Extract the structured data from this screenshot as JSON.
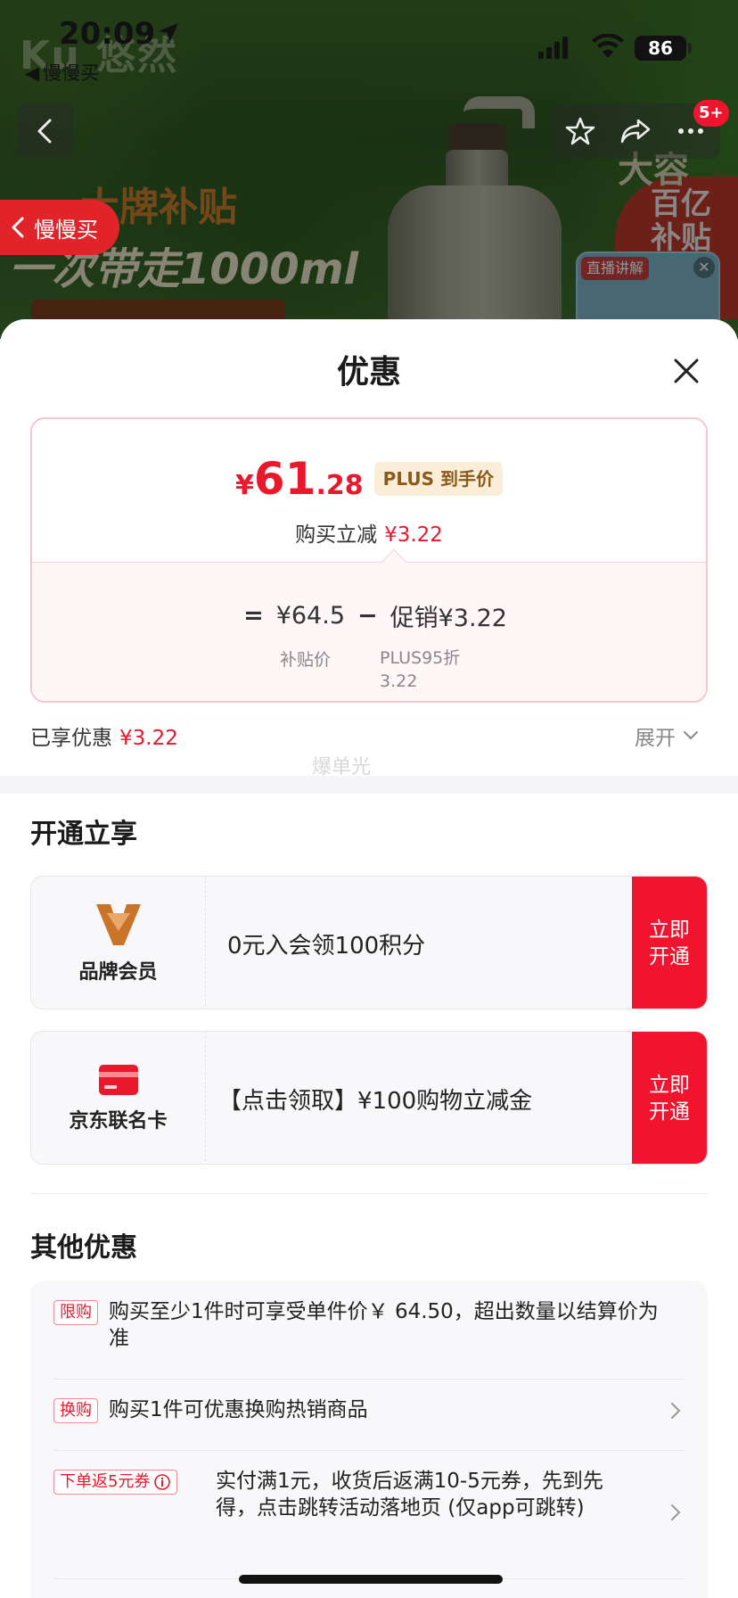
{
  "background": {
    "brand_logo": "Ku 悠然",
    "badge_line1": "大牌补贴",
    "badge_line2": "一次带走1000ml",
    "right_big": "大容",
    "right_label": "百亿补贴",
    "live_label": "直播讲解"
  },
  "status_bar": {
    "time": "20:09",
    "back_app": "慢慢买",
    "battery": "86"
  },
  "nav": {
    "cart_badge": "5+",
    "float_back_label": "慢慢买"
  },
  "sheet": {
    "title": "优惠",
    "price": {
      "currency": "¥",
      "integer": "61",
      "decimal": ".28",
      "plus_tag": "PLUS 到手价",
      "reduce_label": "购买立减",
      "reduce_value": "¥3.22",
      "equals": "=",
      "subsidy_price": "¥64.5",
      "minus": "−",
      "promo": "促销¥3.22",
      "subsidy_label": "补贴价",
      "promo_desc": "PLUS95折\n3.22"
    },
    "enjoyed_label": "已享优惠",
    "enjoyed_value": "¥3.22",
    "expand_label": "展开",
    "watermark": "爆单光"
  },
  "open_section": {
    "title": "开通立享",
    "cards": [
      {
        "name": "品牌会员",
        "text": "0元入会领100积分",
        "button": "立即开通"
      },
      {
        "name": "京东联名卡",
        "text": "【点击领取】¥100购物立减金",
        "button": "立即开通"
      }
    ]
  },
  "other_section": {
    "title": "其他优惠",
    "rows": [
      {
        "tag": "限购",
        "text": "购买至少1件时可享受单件价￥ 64.50，超出数量以结算价为准"
      },
      {
        "tag": "换购",
        "text": "购买1件可优惠换购热销商品"
      },
      {
        "tag": "下单返5元券",
        "text": "实付满1元，收货后返满10-5元券，先到先得，点击跳转活动落地页 (仅app可跳转)"
      }
    ]
  },
  "colors": {
    "accent_red": "#e8192c",
    "button_red": "#f0142e",
    "plus_gold": "#8a5a1a"
  }
}
